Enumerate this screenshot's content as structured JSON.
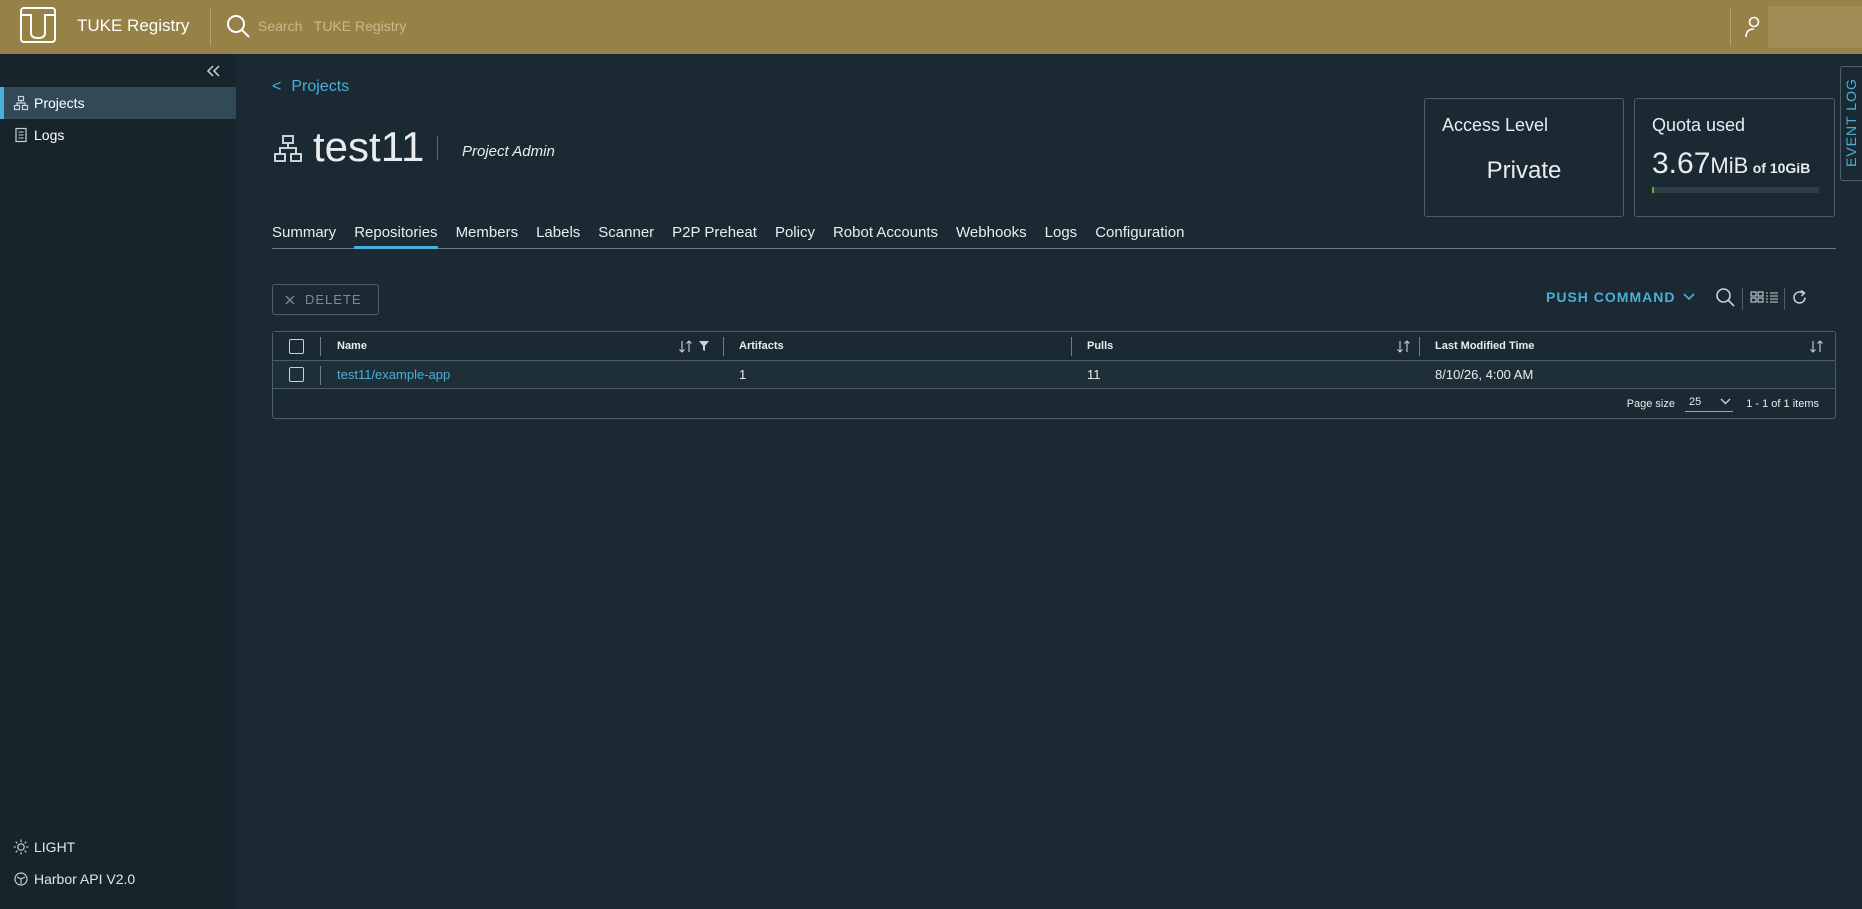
{
  "header": {
    "app_title": "TUKE Registry",
    "search_placeholder": "Search   TUKE Registry"
  },
  "sidebar": {
    "items": [
      {
        "label": "Projects",
        "icon": "projects-icon",
        "active": true
      },
      {
        "label": "Logs",
        "icon": "logs-icon",
        "active": false
      }
    ],
    "theme_toggle": "LIGHT",
    "api_link": "Harbor API V2.0"
  },
  "project": {
    "back_label": "Projects",
    "name": "test11",
    "role": "Project Admin"
  },
  "access_card": {
    "title": "Access Level",
    "value": "Private"
  },
  "quota_card": {
    "title": "Quota used",
    "used_value": "3.67",
    "used_unit": "MiB",
    "of_label": "of 10GiB",
    "used_fraction": 0.0004
  },
  "event_log_label": "EVENT LOG",
  "tabs": [
    {
      "label": "Summary",
      "active": false
    },
    {
      "label": "Repositories",
      "active": true
    },
    {
      "label": "Members",
      "active": false
    },
    {
      "label": "Labels",
      "active": false
    },
    {
      "label": "Scanner",
      "active": false
    },
    {
      "label": "P2P Preheat",
      "active": false
    },
    {
      "label": "Policy",
      "active": false
    },
    {
      "label": "Robot Accounts",
      "active": false
    },
    {
      "label": "Webhooks",
      "active": false
    },
    {
      "label": "Logs",
      "active": false
    },
    {
      "label": "Configuration",
      "active": false
    }
  ],
  "toolbar": {
    "delete_label": "DELETE",
    "push_command_label": "PUSH COMMAND"
  },
  "table": {
    "columns": [
      "Name",
      "Artifacts",
      "Pulls",
      "Last Modified Time"
    ],
    "rows": [
      {
        "name": "test11/example-app",
        "artifacts": "1",
        "pulls": "11",
        "last_modified": "8/10/26, 4:00 AM"
      }
    ],
    "page_size_label": "Page size",
    "page_size": "25",
    "page_info": "1 - 1 of 1 items"
  },
  "colors": {
    "header_bg": "#968147",
    "accent": "#49afd9",
    "background": "#1b2a32"
  }
}
